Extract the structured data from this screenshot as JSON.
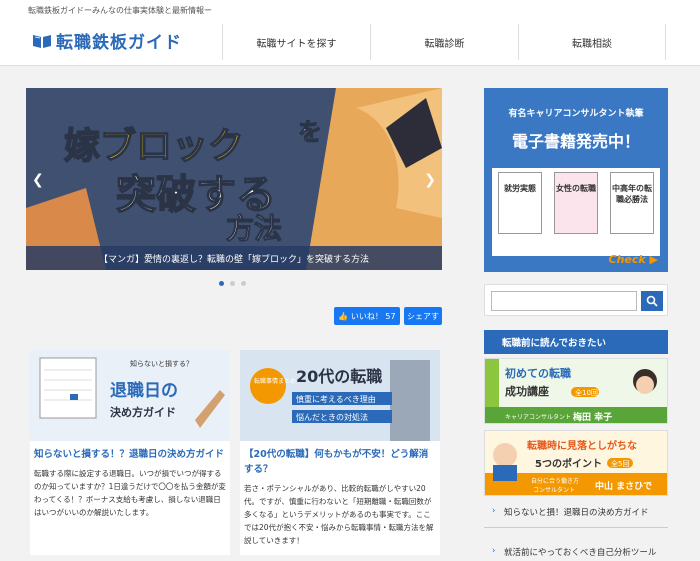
{
  "header": {
    "tagline": "転職鉄板ガイドーみんなの仕事実体験と最新情報ー",
    "logo_text": "転職鉄板ガイド",
    "nav": [
      "転職サイトを探す",
      "転職診断",
      "転職相談"
    ]
  },
  "slider": {
    "headline_1": "嫁ブロック",
    "headline_1b": "を",
    "headline_2": "突破する",
    "headline_3": "方法",
    "caption": "【マンガ】愛情の裏返し？転職の壁「嫁ブロック」を突破する方法",
    "dot_count": 3,
    "active_dot": 0
  },
  "social": {
    "like_label": "👍 いいね！ 57",
    "share_label": "シェアす"
  },
  "cards": [
    {
      "thumb_small": "知らないと損する？",
      "thumb_big_1": "退職日の",
      "thumb_big_2": "決め方ガイド",
      "title": "知らないと損する！？退職日の決め方ガイド",
      "body": "転職する際に設定する退職日。いつが損でいつが得するのか知っていますか？1日違うだけで〇〇を払う金額が変わってくる！？ボーナス支給も考慮し、損しない退職日はいつがいいのか解説いたします。"
    },
    {
      "thumb_badge": "転職事情まとめ",
      "thumb_big_1": "20代の転職",
      "thumb_sub_1": "慎重に考えるべき理由",
      "thumb_sub_2": "悩んだときの対処法",
      "title": "【20代の転職】何もかもが不安！どう解消する？",
      "body": "若さ・ポテンシャルがあり、比較的転職がしやすい20代。ですが、慎重に行わないと「短期離職・転職回数が多くなる」というデメリットがあるのも事実です。ここでは20代が抱く不安・悩みから転職事情・転職方法を解説していきます！"
    }
  ],
  "sidebar": {
    "ebook_top": "有名キャリアコンサルタント執筆",
    "ebook_main": "電子書籍発売中！",
    "books": [
      "就労実態",
      "女性の転職",
      "中高年の転職必勝法"
    ],
    "check": "Check ▶",
    "search_placeholder": "",
    "section_title": "転職前に読んでおきたい",
    "banner_1": {
      "title_1": "初めての転職",
      "title_2": "成功講座",
      "badge": "全10回",
      "role": "キャリアコンサルタント",
      "name": "梅田 幸子"
    },
    "banner_2": {
      "title_1": "転職時に見落としがちな",
      "title_2": "5つのポイント",
      "badge": "全5回",
      "role_1": "自分に合う働き方",
      "role_2": "コンサルタント",
      "name": "中山 まさひで"
    },
    "links": [
      "知らないと損！退職日の決め方ガイド",
      "就活前にやっておくべき自己分析ツール"
    ]
  },
  "colors": {
    "brand": "#2a6ab8",
    "accent": "#f39800",
    "facebook": "#1877f2"
  }
}
